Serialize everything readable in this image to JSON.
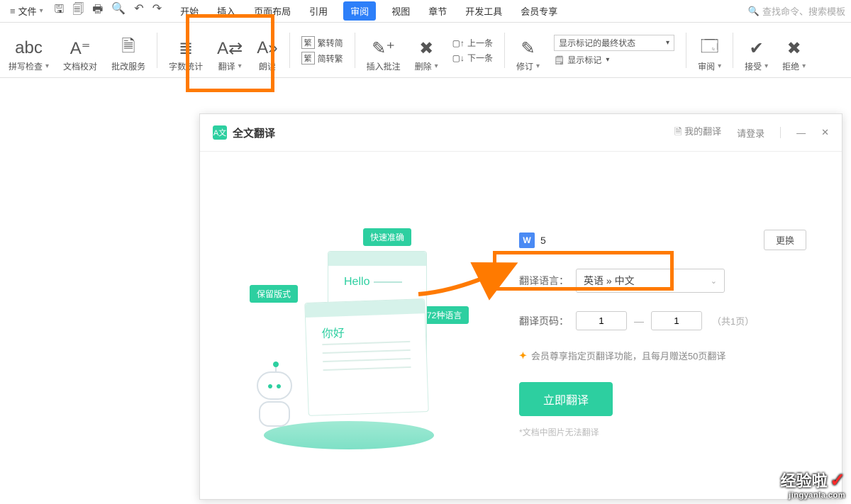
{
  "menubar": {
    "file": "文件",
    "tabs": [
      "开始",
      "插入",
      "页面布局",
      "引用",
      "审阅",
      "视图",
      "章节",
      "开发工具",
      "会员专享"
    ],
    "active_tab_index": 4,
    "search_placeholder": "查找命令、搜索模板"
  },
  "ribbon": {
    "spellcheck": "拼写检查",
    "docproof": "文档校对",
    "reviewsvc": "批改服务",
    "wordcount": "字数统计",
    "translate": "翻译",
    "readaloud": "朗读",
    "s2t_icon": "繁",
    "s2t": "繁转简",
    "t2s": "简转繁",
    "newcomment": "插入批注",
    "delete": "删除",
    "prev": "上一条",
    "next": "下一条",
    "track": "修订",
    "display_combo": "显示标记的最终状态",
    "showmarkup": "显示标记",
    "reviewpane": "审阅",
    "accept": "接受",
    "reject": "拒绝"
  },
  "dialog": {
    "title": "全文翻译",
    "my_trans": "我的翻译",
    "login": "请登录",
    "illus": {
      "fast": "快速准确",
      "keep": "保留版式",
      "langs": "72种语言",
      "hello": "Hello",
      "nihao": "你好"
    },
    "doc_count": "5",
    "change_btn": "更换",
    "lang_label": "翻译语言：",
    "lang_value": "英语 » 中文",
    "page_label": "翻译页码：",
    "page_from": "1",
    "page_to": "1",
    "page_total": "（共1页）",
    "vip_note": "会员尊享指定页翻译功能，且每月赠送50页翻译",
    "go_btn": "立即翻译",
    "footnote": "*文档中图片无法翻译"
  },
  "watermark": {
    "brand": "经验啦",
    "url": "jingyanla.com"
  }
}
